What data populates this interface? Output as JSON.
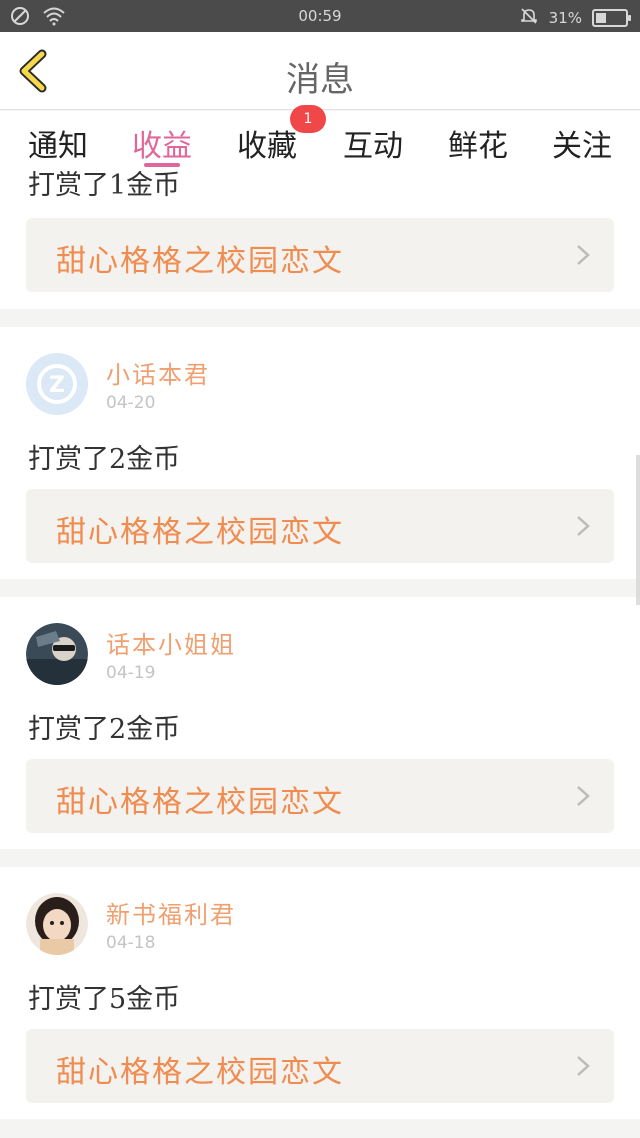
{
  "status_bar": {
    "time": "00:59",
    "battery": "31%",
    "battery_level": 0.31
  },
  "header": {
    "title": "消息",
    "back_icon": "chevron-left-icon"
  },
  "tabs": [
    {
      "label": "通知",
      "active": false
    },
    {
      "label": "收益",
      "active": true
    },
    {
      "label": "收藏",
      "active": false,
      "badge": "1"
    },
    {
      "label": "互动",
      "active": false
    },
    {
      "label": "鲜花",
      "active": false
    },
    {
      "label": "关注",
      "active": false
    }
  ],
  "feed": [
    {
      "user": "",
      "date": "",
      "reward": "打赏了1金币",
      "book": "甜心格格之校园恋文"
    },
    {
      "user": "小话本君",
      "date": "04-20",
      "reward": "打赏了2金币",
      "book": "甜心格格之校园恋文",
      "avatar": "z-logo-avatar"
    },
    {
      "user": "话本小姐姐",
      "date": "04-19",
      "reward": "打赏了2金币",
      "book": "甜心格格之校园恋文",
      "avatar": "photo-avatar"
    },
    {
      "user": "新书福利君",
      "date": "04-18",
      "reward": "打赏了5金币",
      "book": "甜心格格之校园恋文",
      "avatar": "girl-photo-avatar"
    }
  ],
  "colors": {
    "accent": "#e0679a",
    "book_title": "#f08c50",
    "username": "#f0a070",
    "badge": "#f04848"
  }
}
